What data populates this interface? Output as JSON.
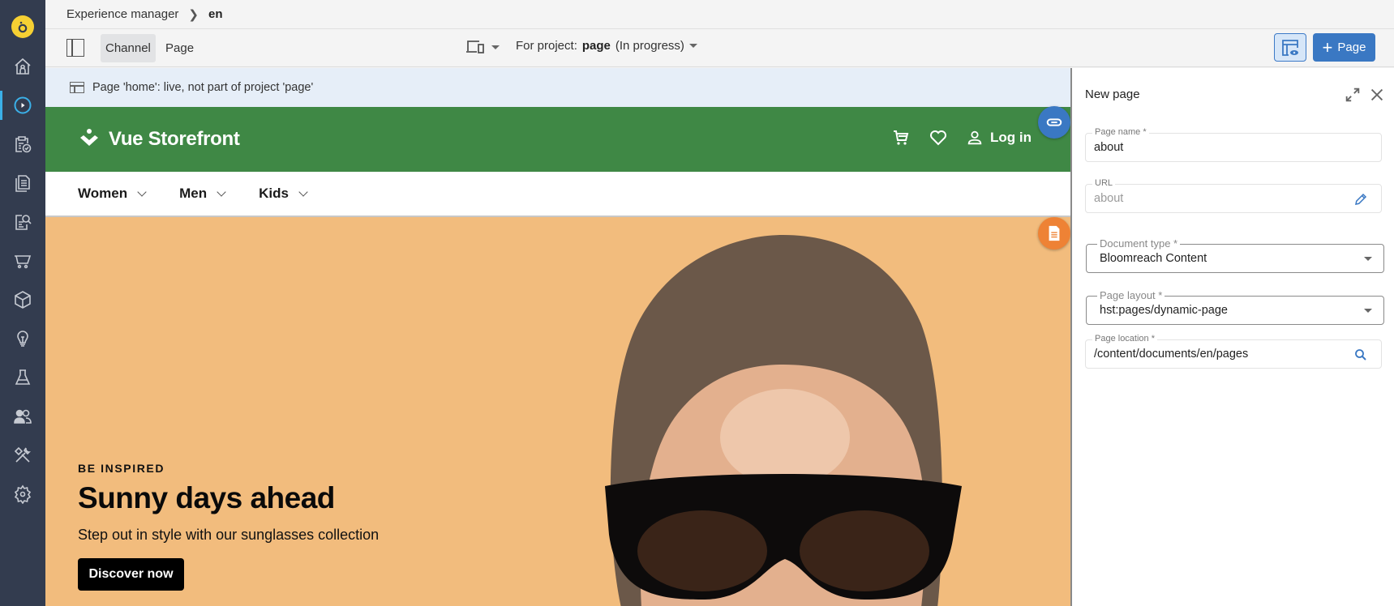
{
  "breadcrumb": {
    "root": "Experience manager",
    "current": "en"
  },
  "sidebar": {
    "items": [
      {
        "name": "home",
        "icon": "home-icon"
      },
      {
        "name": "experience-manager",
        "icon": "play-circle-icon",
        "active": true
      },
      {
        "name": "projects",
        "icon": "clipboard-check-icon"
      },
      {
        "name": "content",
        "icon": "documents-icon"
      },
      {
        "name": "content-search",
        "icon": "document-search-icon"
      },
      {
        "name": "commerce",
        "icon": "cart-icon"
      },
      {
        "name": "components",
        "icon": "cube-icon"
      },
      {
        "name": "insights",
        "icon": "lightbulb-icon"
      },
      {
        "name": "experiments",
        "icon": "flask-icon"
      },
      {
        "name": "audiences",
        "icon": "users-icon"
      },
      {
        "name": "developer-tools",
        "icon": "tools-icon"
      },
      {
        "name": "settings",
        "icon": "gear-icon"
      }
    ]
  },
  "toolbar": {
    "tabs": [
      {
        "label": "Channel",
        "active": true
      },
      {
        "label": "Page",
        "active": false
      }
    ],
    "project_prefix": "For project:",
    "project_name": "page",
    "project_status": "(In progress)",
    "add_page_label": "Page"
  },
  "banner": {
    "text": "Page 'home': live, not part of project 'page'"
  },
  "site": {
    "brand": "Vue Storefront",
    "login": "Log in",
    "nav": [
      {
        "label": "Women"
      },
      {
        "label": "Men"
      },
      {
        "label": "Kids"
      }
    ],
    "hero": {
      "kicker": "BE INSPIRED",
      "title": "Sunny days ahead",
      "subtitle": "Step out in style with our sunglasses collection",
      "cta": "Discover now",
      "background": "#f2bc7d"
    },
    "header_color": "#3f8845"
  },
  "panel": {
    "title": "New page",
    "fields": {
      "page_name": {
        "label": "Page name *",
        "value": "about"
      },
      "url": {
        "label": "URL",
        "value": "about"
      },
      "document_type": {
        "label": "Document type *",
        "value": "Bloomreach Content"
      },
      "page_layout": {
        "label": "Page layout *",
        "value": "hst:pages/dynamic-page"
      },
      "page_location": {
        "label": "Page location *",
        "value": "/content/documents/en/pages"
      }
    }
  },
  "colors": {
    "accent": "#3a78c3",
    "sidebar": "#333c4f",
    "logo": "#f6d033",
    "fab_doc": "#ee8235"
  }
}
